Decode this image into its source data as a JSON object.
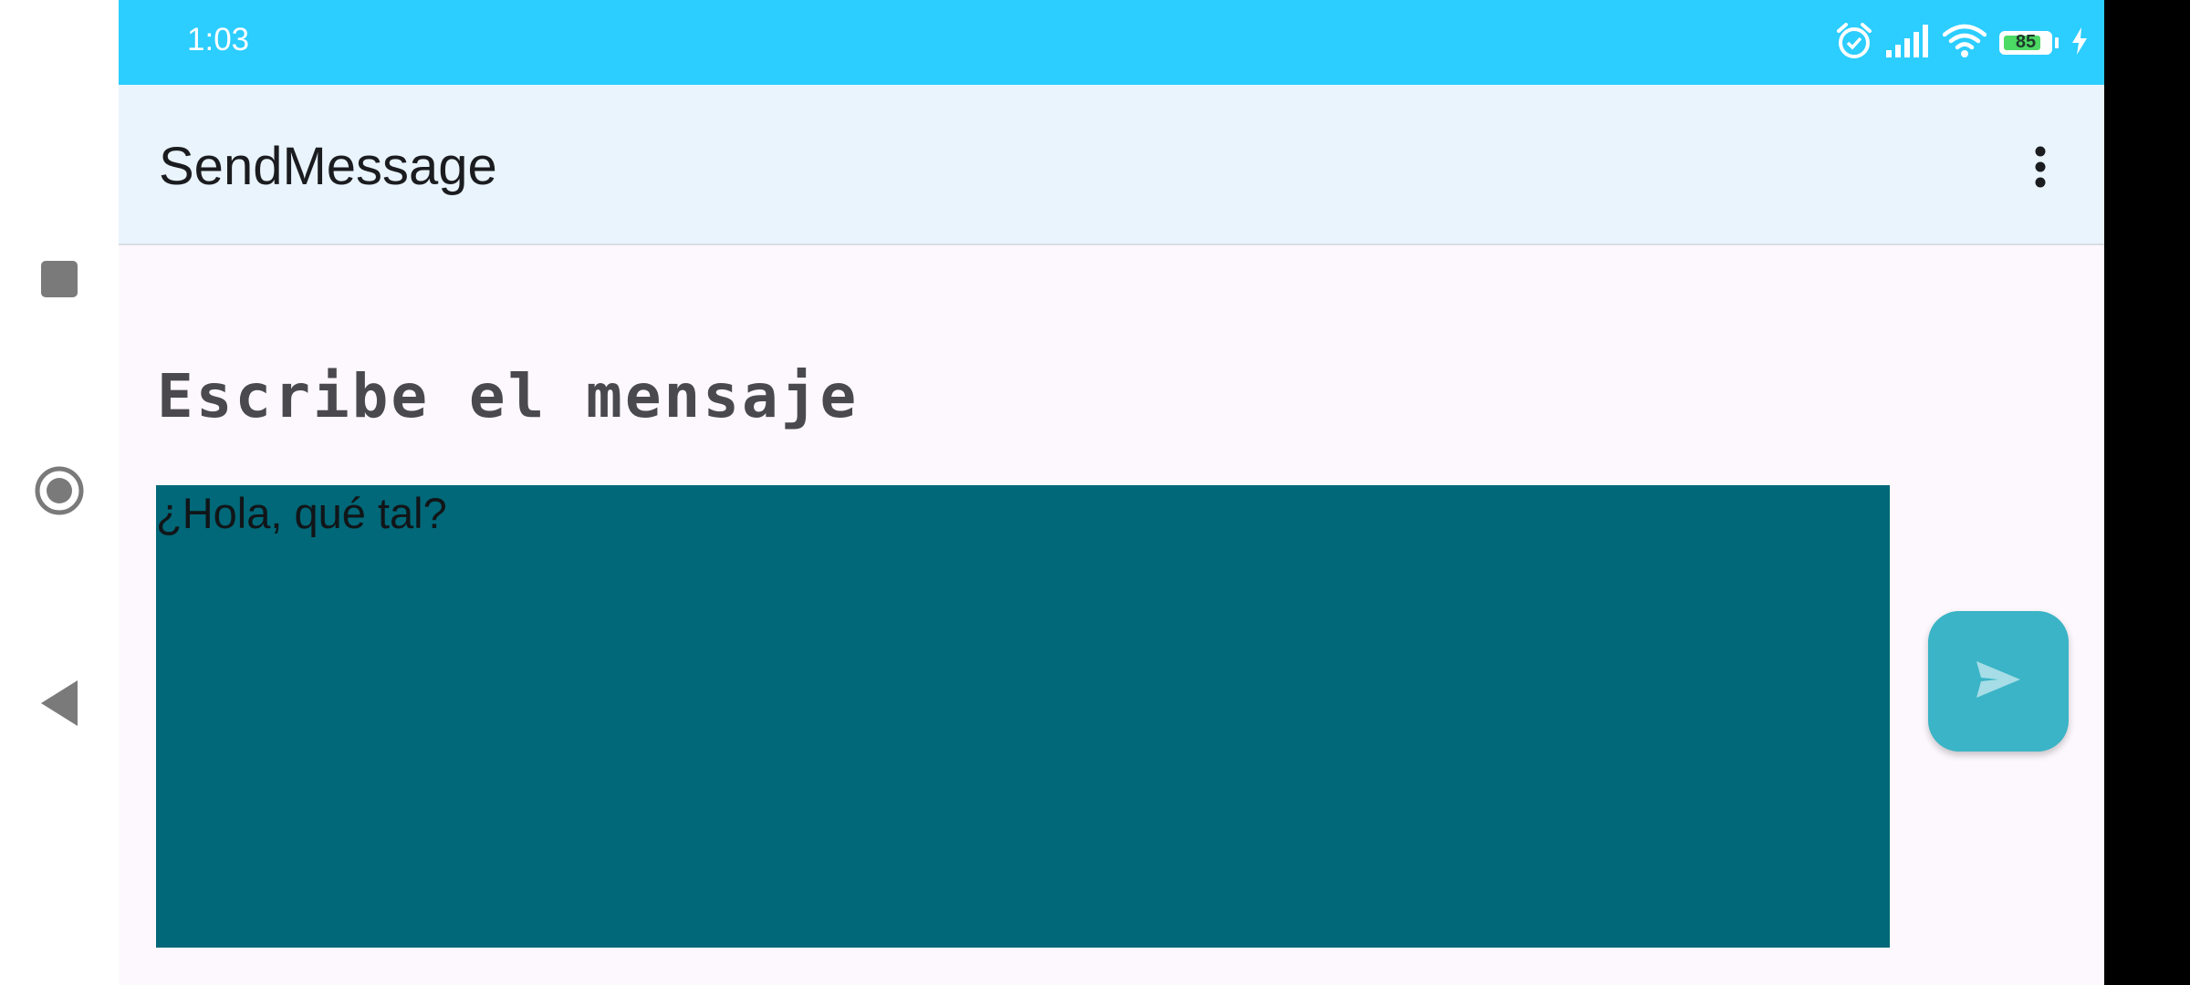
{
  "status_bar": {
    "time": "1:03",
    "battery_level": "85",
    "battery_percent": 85,
    "icons": [
      "alarm-icon",
      "signal-icon",
      "wifi-icon",
      "battery-icon",
      "charging-icon"
    ]
  },
  "app_bar": {
    "title": "SendMessage",
    "menu_icon": "more-vert-icon"
  },
  "main": {
    "heading": "Escribe el mensaje",
    "message_value": "¿Hola, qué tal?",
    "send_icon": "send-icon"
  },
  "nav": {
    "icons": [
      "recents-icon",
      "home-icon",
      "back-icon"
    ]
  },
  "colors": {
    "status_bar": "#2ccdff",
    "app_bar": "#e9f4fd",
    "message_box": "#006878",
    "send_button": "#3ab4c6",
    "background": "#fdf8fd"
  }
}
